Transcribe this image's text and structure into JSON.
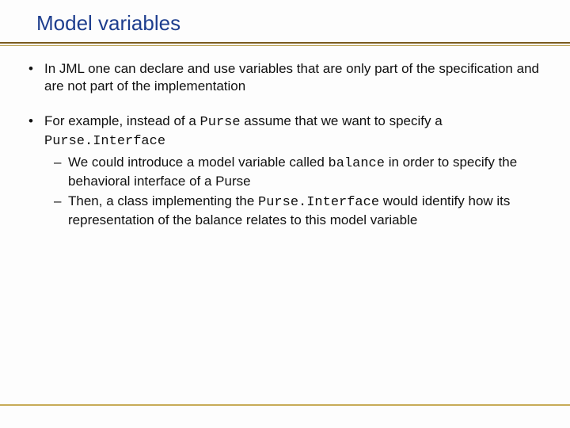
{
  "title": "Model variables",
  "bullet1": "In JML one can declare and use variables that are only part of the specification and are not part of the implementation",
  "b2_pre": "For example, instead of a ",
  "b2_code1": "Purse",
  "b2_mid": " assume that we want to specify a ",
  "b2_code2": "Purse.Interface",
  "s1_pre": "We could introduce a model variable called ",
  "s1_code": "balance",
  "s1_post": " in order to specify the behavioral interface of a Purse",
  "s2_pre": "Then, a class implementing the ",
  "s2_code": "Purse.Interface",
  "s2_post": " would identify how its representation of the balance relates to this model variable"
}
